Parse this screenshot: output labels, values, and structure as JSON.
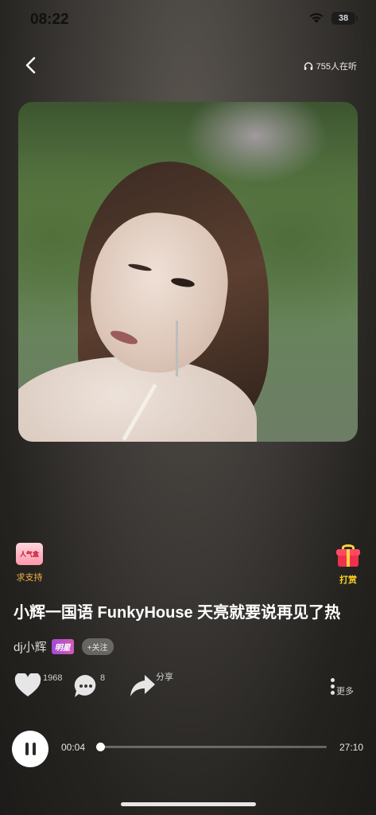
{
  "status_bar": {
    "time": "08:22",
    "battery": "38"
  },
  "header": {
    "listeners": "755人在听"
  },
  "actions_top": {
    "support_label": "求支持",
    "support_badge_text": "人气盒",
    "reward_label": "打赏"
  },
  "song": {
    "title": "小辉一国语 FunkyHouse 天亮就要说再见了热",
    "artist": "dj小辉",
    "badge": "明星",
    "follow_label": "+关注"
  },
  "stats": {
    "likes": "1968",
    "comments": "8",
    "share_label": "分享",
    "more_label": "更多"
  },
  "player": {
    "current_time": "00:04",
    "total_time": "27:10",
    "progress": 0.002
  },
  "colors": {
    "support": "#f3b04a",
    "reward": "#ffd21f",
    "badge_gradient_start": "#a24bd6"
  }
}
